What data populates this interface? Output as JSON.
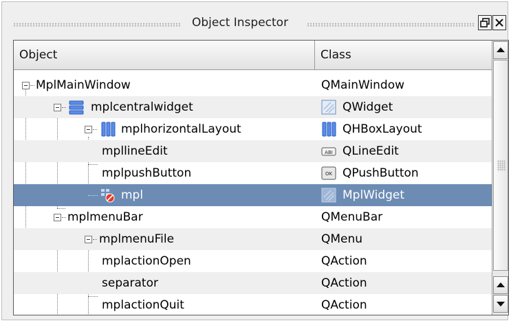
{
  "window": {
    "title": "Object Inspector",
    "float_button": "🗗",
    "close_button": "✕"
  },
  "columns": {
    "object": "Object",
    "class": "Class"
  },
  "rows": [
    {
      "object": "MplMainWindow",
      "class": "QMainWindow",
      "object_icon": "",
      "class_icon": ""
    },
    {
      "object": "mplcentralwidget",
      "class": "QWidget",
      "object_icon": "vertical-layout-icon",
      "class_icon": "widget-icon"
    },
    {
      "object": "mplhorizontalLayout",
      "class": "QHBoxLayout",
      "object_icon": "horizontal-layout-icon",
      "class_icon": "horizontal-layout-icon"
    },
    {
      "object": "mpllineEdit",
      "class": "QLineEdit",
      "object_icon": "",
      "class_icon": "lineedit-icon"
    },
    {
      "object": "mplpushButton",
      "class": "QPushButton",
      "object_icon": "",
      "class_icon": "pushbutton-icon"
    },
    {
      "object": "mpl",
      "class": "MplWidget",
      "object_icon": "broken-layout-icon",
      "class_icon": "widget-icon",
      "selected": true
    },
    {
      "object": "mplmenuBar",
      "class": "QMenuBar",
      "object_icon": "",
      "class_icon": ""
    },
    {
      "object": "mplmenuFile",
      "class": "QMenu",
      "object_icon": "",
      "class_icon": ""
    },
    {
      "object": "mplactionOpen",
      "class": "QAction",
      "object_icon": "",
      "class_icon": ""
    },
    {
      "object": "separator",
      "class": "QAction",
      "object_icon": "",
      "class_icon": ""
    },
    {
      "object": "mplactionQuit",
      "class": "QAction",
      "object_icon": "",
      "class_icon": ""
    }
  ],
  "icons": {
    "lineedit_text": "ABI",
    "pushbutton_text": "OK"
  },
  "colors": {
    "selection": "#6c8cb4",
    "layout_blue": "#3a6ed8",
    "alt_row": "#efefef"
  }
}
